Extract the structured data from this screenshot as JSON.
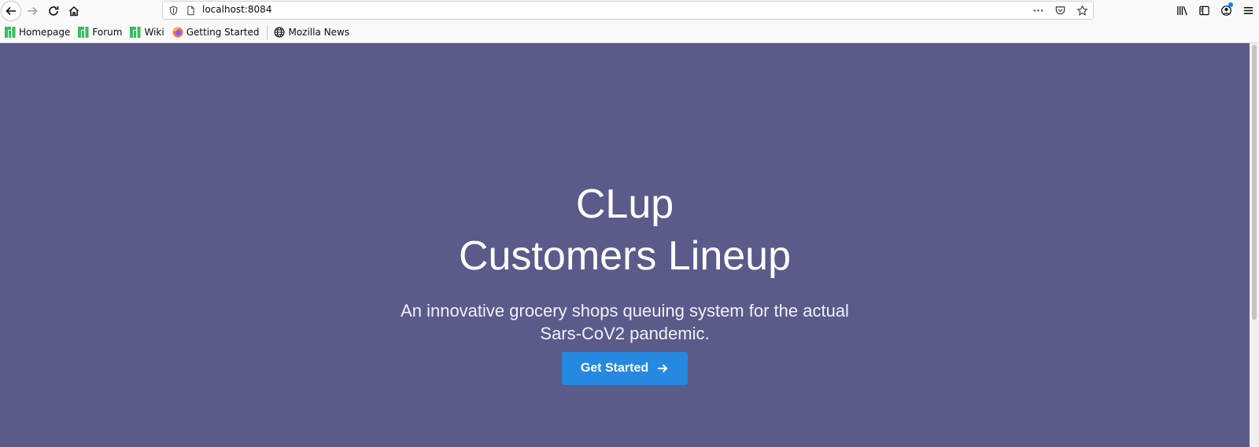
{
  "browser": {
    "url": "localhost:8084",
    "bookmarks": [
      {
        "label": "Homepage",
        "icon": "manjaro-icon"
      },
      {
        "label": "Forum",
        "icon": "manjaro-icon"
      },
      {
        "label": "Wiki",
        "icon": "manjaro-icon"
      },
      {
        "label": "Getting Started",
        "icon": "firefox-icon"
      },
      {
        "label": "Mozilla News",
        "icon": "globe-icon"
      }
    ]
  },
  "hero": {
    "title_line1": "CLup",
    "title_line2": "Customers Lineup",
    "subtitle_line1": "An innovative grocery shops queuing system for the actual",
    "subtitle_line2": "Sars-CoV2 pandemic.",
    "cta_label": "Get Started"
  },
  "colors": {
    "hero_bg": "#5a5b8a",
    "cta_bg": "#2689e0",
    "manjaro_green": "#35bf5c"
  }
}
